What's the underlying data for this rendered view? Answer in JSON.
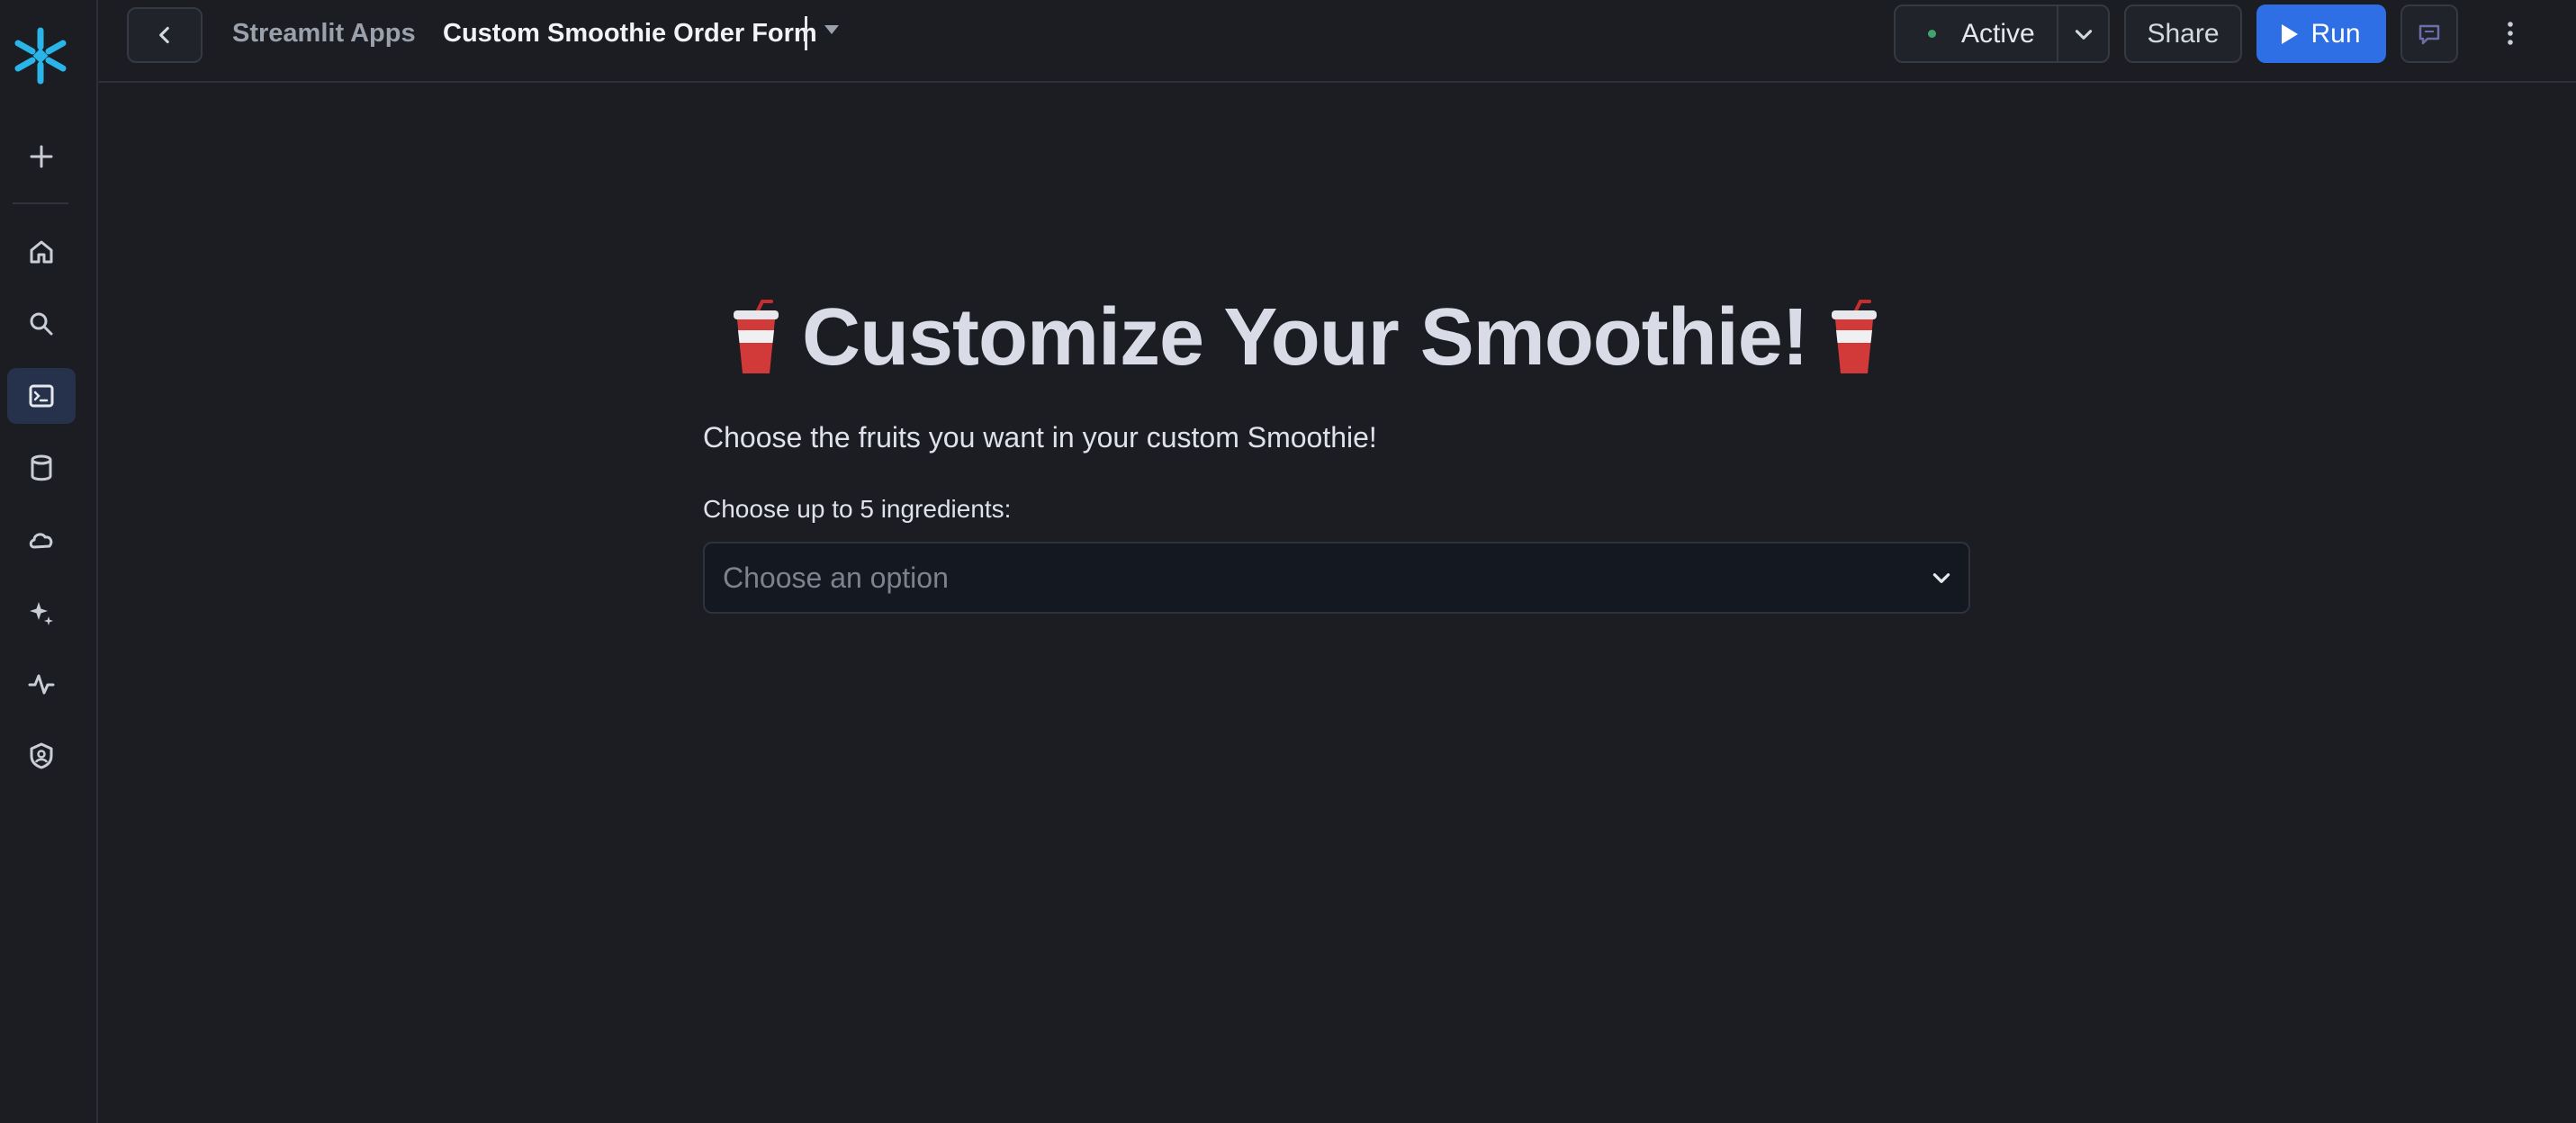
{
  "topbar": {
    "breadcrumb_parent": "Streamlit Apps",
    "app_title": "Custom Smoothie Order Form",
    "status_label": "Active",
    "share_label": "Share",
    "run_label": "Run"
  },
  "sidebar": {
    "items": [
      {
        "icon": "plus-icon"
      },
      {
        "icon": "home-icon"
      },
      {
        "icon": "search-icon"
      },
      {
        "icon": "terminal-icon",
        "active": true
      },
      {
        "icon": "database-icon"
      },
      {
        "icon": "cloud-icon"
      },
      {
        "icon": "sparkle-icon"
      },
      {
        "icon": "activity-icon"
      },
      {
        "icon": "shield-user-icon"
      }
    ]
  },
  "main": {
    "heading": "Customize Your Smoothie!",
    "subtitle": "Choose the fruits you want in your custom Smoothie!",
    "multiselect_label": "Choose up to 5 ingredients:",
    "multiselect_placeholder": "Choose an option"
  },
  "colors": {
    "background": "#1b1d22",
    "accent": "#2f6fe6",
    "status_dot": "#3fa56d"
  }
}
